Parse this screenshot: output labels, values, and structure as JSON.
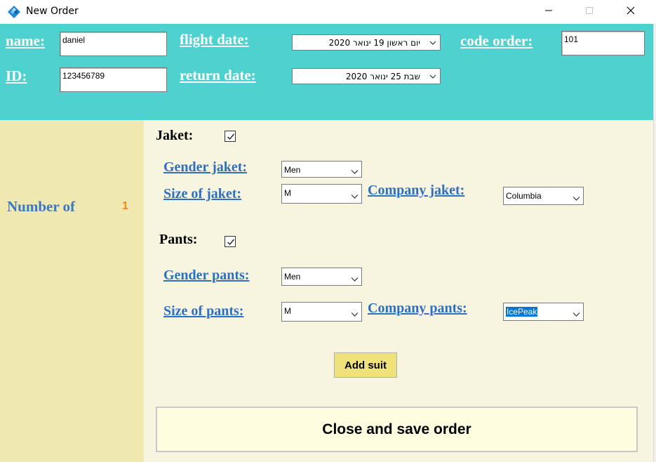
{
  "window": {
    "title": "New Order",
    "icon": "app-diamond-icon",
    "controls": [
      "minimize-icon",
      "maximize-icon",
      "close-icon"
    ]
  },
  "header": {
    "name_label": "name:",
    "name_value": "daniel",
    "id_label": "ID:",
    "id_value": "123456789",
    "flight_date_label": "flight date:",
    "flight_date_value": "יום ראשון 19 ינואר 2020",
    "return_date_label": "return date:",
    "return_date_value": "שבת 25 ינואר 2020",
    "code_order_label": "code order:",
    "code_order_value": "101"
  },
  "left": {
    "number_label": "Number of",
    "number_value": "1"
  },
  "jacket": {
    "title": "Jaket:",
    "checked": true,
    "gender_label": "Gender jaket:",
    "gender_value": "Men",
    "size_label": "Size of jaket:",
    "size_value": "M",
    "company_label": "Company jaket:",
    "company_value": "Columbia"
  },
  "pants": {
    "title": "Pants:",
    "checked": true,
    "gender_label": "Gender pants:",
    "gender_value": "Men",
    "size_label": "Size of pants:",
    "size_value": "M",
    "company_label": "Company pants:",
    "company_value": "IcePeak"
  },
  "actions": {
    "add_suit": "Add suit",
    "close_save": "Close and save order"
  },
  "colors": {
    "header_bg": "#4ed1cf",
    "left_bg": "#efe8b0",
    "main_bg": "#f7f5df",
    "label_blue": "#2f6fc0",
    "count_orange": "#f08a1e",
    "add_btn_bg": "#f0e27a"
  }
}
